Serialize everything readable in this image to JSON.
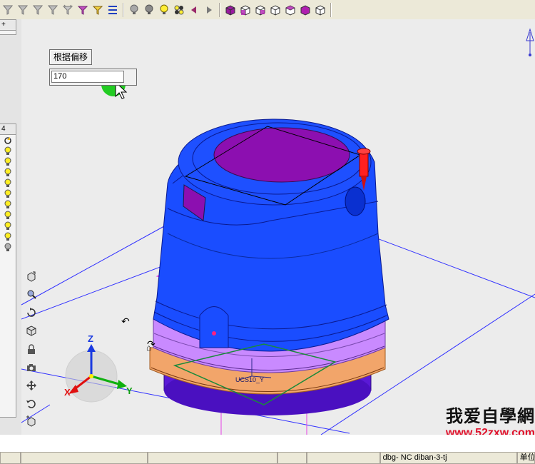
{
  "toolbar": {
    "group1": [
      "select-filter-icon",
      "filter-icon",
      "filter-icon",
      "filter-icon",
      "filter-icon",
      "filter-icon",
      "filter-icon",
      "list-icon"
    ],
    "group2": [
      "light-off-icon",
      "light-off-icon",
      "light-on-icon",
      "lights-icon",
      "arrow-left-icon",
      "arrow-right-icon"
    ],
    "group3": [
      "cube-shaded-icon",
      "cube-wire-icon",
      "cube-wire-icon",
      "cube-wire-icon",
      "cube-wire-icon",
      "cube-shaded-icon",
      "cube-wire-icon"
    ]
  },
  "panel_top": {
    "header": "+"
  },
  "panel_layers": {
    "header": "4",
    "bulbs": [
      "on",
      "on",
      "on",
      "on",
      "on",
      "on",
      "on",
      "on",
      "on",
      "off"
    ]
  },
  "offset": {
    "label": "根据偏移",
    "value": "170"
  },
  "triad": {
    "x": "X",
    "y": "Y",
    "z": "Z"
  },
  "csys_label": "UCS10_Y",
  "colors": {
    "body_blue": "#1a4dff",
    "ring_violet": "#c98aff",
    "ring_orange": "#f2a56a",
    "base_purple": "#5a19d6",
    "cap_magenta": "#8c0fb0",
    "plane_blue": "#3030ff",
    "plane_magenta": "#e640e6",
    "pin_red": "#ff2020"
  },
  "watermark": {
    "cn": "我爱自學網",
    "url": "www.52zxw.com"
  },
  "status": {
    "cells": [
      "",
      "",
      "",
      "",
      "dbg- NC diban-3-tj",
      "单位"
    ]
  }
}
